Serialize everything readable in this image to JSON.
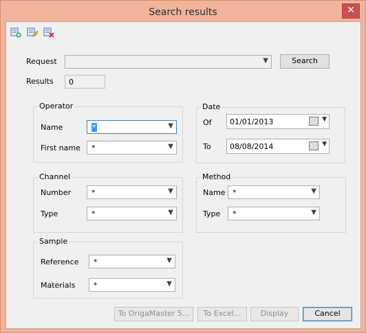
{
  "window": {
    "title": "Search results",
    "close_glyph": "✕"
  },
  "toolbar": {
    "icons": [
      "add-icon",
      "edit-icon",
      "delete-icon"
    ]
  },
  "request": {
    "label": "Request",
    "value": "",
    "search_button": "Search"
  },
  "results": {
    "label": "Results",
    "value": "0"
  },
  "operator": {
    "title": "Operator",
    "name_label": "Name",
    "name_value": "*",
    "first_name_label": "First name",
    "first_name_value": "*"
  },
  "date": {
    "title": "Date",
    "of_label": "Of",
    "of_value": "01/01/2013",
    "to_label": "To",
    "to_value": "08/08/2014"
  },
  "channel": {
    "title": "Channel",
    "number_label": "Number",
    "number_value": "*",
    "type_label": "Type",
    "type_value": "*"
  },
  "method": {
    "title": "Method",
    "name_label": "Name",
    "name_value": "*",
    "type_label": "Type",
    "type_value": "*"
  },
  "sample": {
    "title": "Sample",
    "reference_label": "Reference",
    "reference_value": "*",
    "materials_label": "Materials",
    "materials_value": "*"
  },
  "buttons": {
    "to_origamaster": "To OrigaMaster 5...",
    "to_excel": "To Excel...",
    "display": "Display",
    "cancel": "Cancel"
  },
  "colors": {
    "title_bar": "#f0b49b",
    "close": "#c75050",
    "client": "#f0f0f0"
  }
}
